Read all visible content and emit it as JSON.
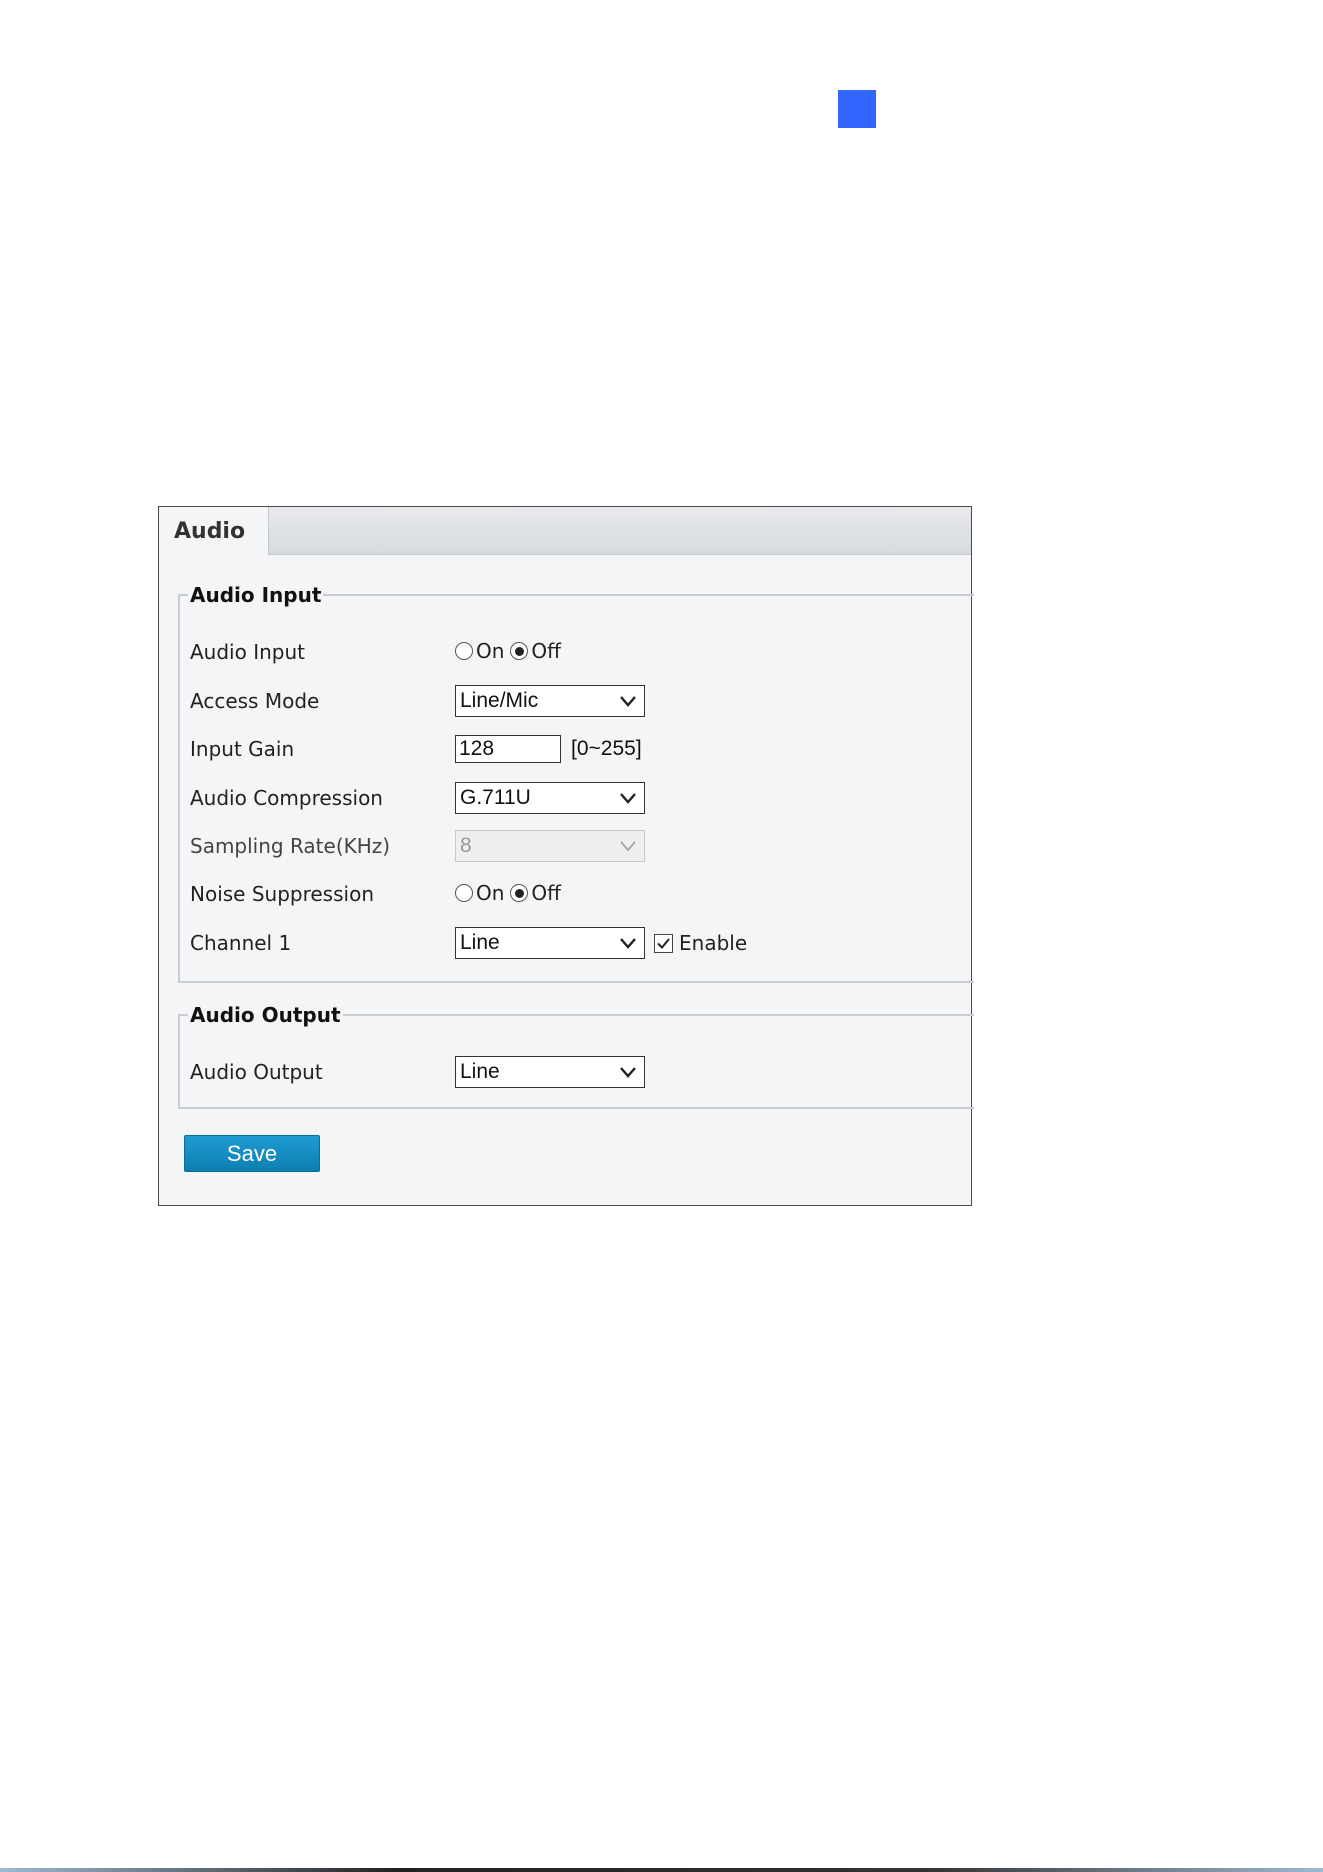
{
  "colors": {
    "marker": "#3366ff",
    "save_button": "#1591c6"
  },
  "tab": {
    "label": "Audio"
  },
  "audio_input": {
    "legend": "Audio Input",
    "audio_input": {
      "label": "Audio Input",
      "on_label": "On",
      "off_label": "Off",
      "selected": "Off"
    },
    "access_mode": {
      "label": "Access Mode",
      "value": "Line/Mic"
    },
    "input_gain": {
      "label": "Input Gain",
      "value": "128",
      "range": "[0~255]"
    },
    "audio_compression": {
      "label": "Audio Compression",
      "value": "G.711U"
    },
    "sampling_rate": {
      "label": "Sampling Rate(KHz)",
      "value": "8",
      "disabled": true
    },
    "noise_suppression": {
      "label": "Noise Suppression",
      "on_label": "On",
      "off_label": "Off",
      "selected": "Off"
    },
    "channel_1": {
      "label": "Channel 1",
      "value": "Line",
      "enable_label": "Enable",
      "enabled": true
    }
  },
  "audio_output": {
    "legend": "Audio Output",
    "audio_output": {
      "label": "Audio Output",
      "value": "Line"
    }
  },
  "save": {
    "label": "Save"
  }
}
